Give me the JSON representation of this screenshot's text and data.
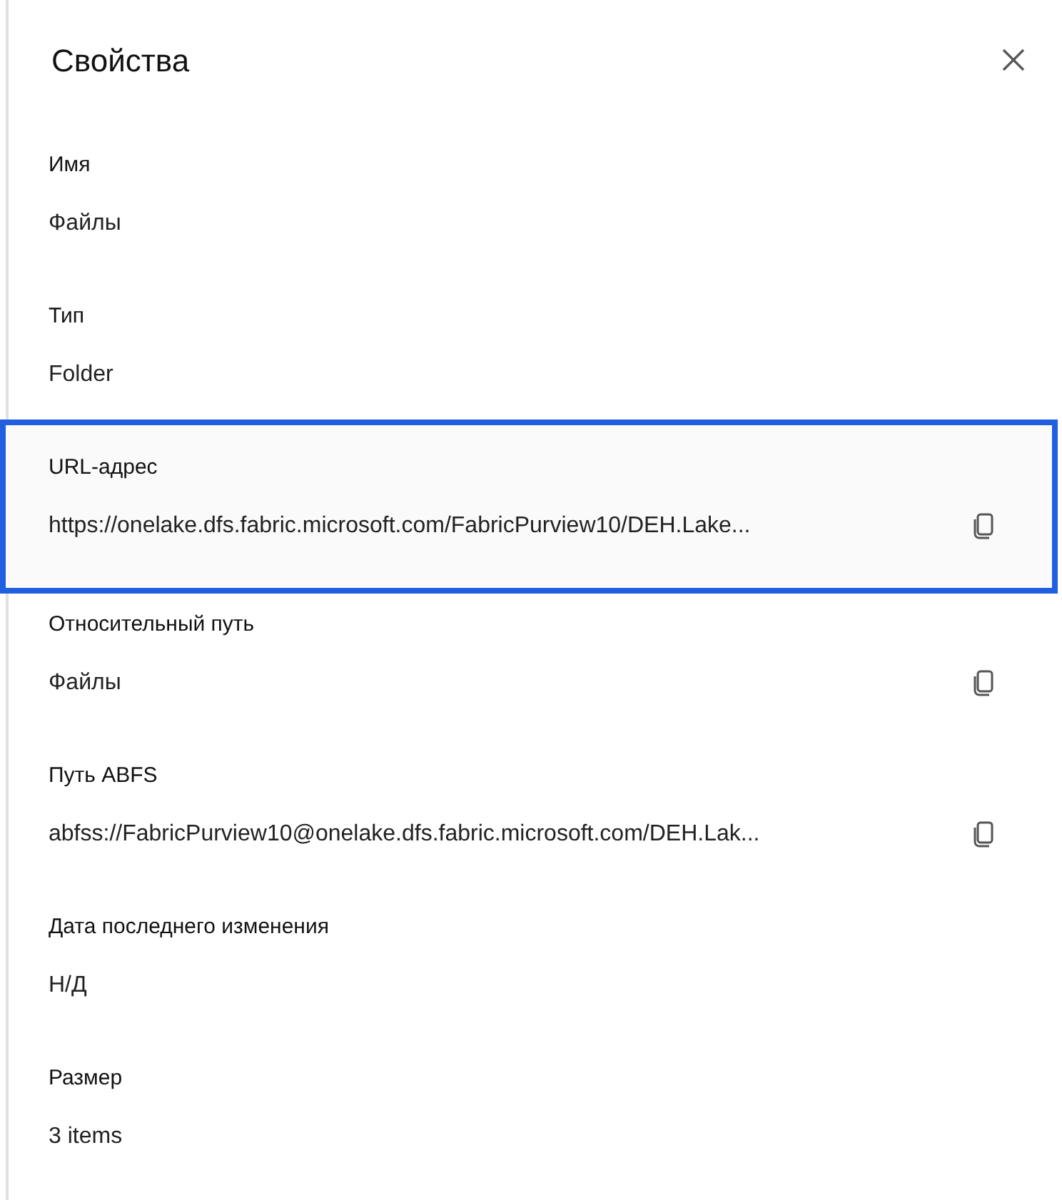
{
  "panel": {
    "title": "Свойства"
  },
  "properties": [
    {
      "label": "Имя",
      "value": "Файлы",
      "copyable": false,
      "highlighted": false
    },
    {
      "label": "Тип",
      "value": "Folder",
      "copyable": false,
      "highlighted": false
    },
    {
      "label": "URL-адрес",
      "value": "https://onelake.dfs.fabric.microsoft.com/FabricPurview10/DEH.Lake...",
      "copyable": true,
      "highlighted": true
    },
    {
      "label": "Относительный путь",
      "value": "Файлы",
      "copyable": true,
      "highlighted": false
    },
    {
      "label": "Путь ABFS",
      "value": "abfss://FabricPurview10@onelake.dfs.fabric.microsoft.com/DEH.Lak...",
      "copyable": true,
      "highlighted": false
    },
    {
      "label": "Дата последнего изменения",
      "value": "Н/Д",
      "copyable": false,
      "highlighted": false
    },
    {
      "label": "Размер",
      "value": "3 items",
      "copyable": false,
      "highlighted": false
    }
  ]
}
